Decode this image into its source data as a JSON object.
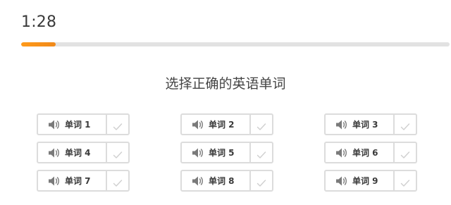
{
  "timer": "1:28",
  "progress": {
    "fraction": 0.08
  },
  "instruction": "选择正确的英语单词",
  "icons": {
    "play": "speaker-icon",
    "confirm": "check-icon"
  },
  "colors": {
    "progress": "#ff9a1a",
    "track": "#e2e2e2",
    "border": "#dcdcdc"
  },
  "words": [
    {
      "label": "单词 1"
    },
    {
      "label": "单词 2"
    },
    {
      "label": "单词 3"
    },
    {
      "label": "单词 4"
    },
    {
      "label": "单词 5"
    },
    {
      "label": "单词 6"
    },
    {
      "label": "单词 7"
    },
    {
      "label": "单词 8"
    },
    {
      "label": "单词 9"
    }
  ]
}
